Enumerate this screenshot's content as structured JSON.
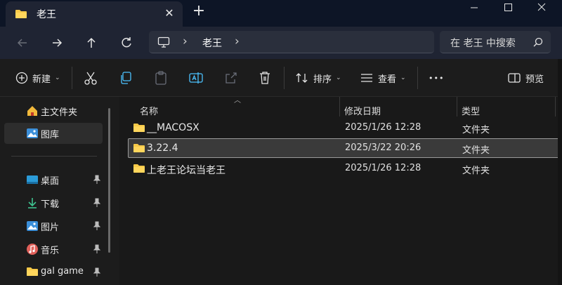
{
  "tab": {
    "title": "老王",
    "close_glyph": "✕",
    "new_tab_glyph": "+"
  },
  "window_controls": [
    "minimize-icon",
    "maximize-icon",
    "close-icon"
  ],
  "nav": {
    "buttons": [
      "back-arrow-icon",
      "forward-arrow-icon",
      "up-arrow-icon",
      "refresh-icon"
    ]
  },
  "address": {
    "separator": "›",
    "crumb": "老王",
    "trailing": "›"
  },
  "search": {
    "placeholder": "在 老王 中搜索"
  },
  "toolbar": {
    "new_label": "新建",
    "sort_label": "排序",
    "view_label": "查看",
    "more_glyph": "•••",
    "preview_label": "预览",
    "caret": "⌄"
  },
  "sidebar": {
    "items": [
      {
        "label": "主文件夹",
        "icon": "home-icon",
        "pinned": false
      },
      {
        "label": "图库",
        "icon": "gallery-icon",
        "pinned": false,
        "selected": true
      },
      {
        "label": "桌面",
        "icon": "desktop-icon",
        "pinned": true
      },
      {
        "label": "下载",
        "icon": "download-icon",
        "pinned": true
      },
      {
        "label": "图片",
        "icon": "pictures-icon",
        "pinned": true
      },
      {
        "label": "音乐",
        "icon": "music-icon",
        "pinned": true
      },
      {
        "label": "gal game",
        "icon": "folder-icon",
        "pinned": true
      }
    ]
  },
  "columns": {
    "name": "名称",
    "modified": "修改日期",
    "type": "类型"
  },
  "files": [
    {
      "name": "__MACOSX",
      "modified": "2025/1/26 12:28",
      "type": "文件夹"
    },
    {
      "name": "3.22.4",
      "modified": "2025/3/22 20:26",
      "type": "文件夹",
      "selected": true
    },
    {
      "name": "上老王论坛当老王",
      "modified": "2025/1/26 12:28",
      "type": "文件夹"
    }
  ],
  "colors": {
    "folder": "#f7c948",
    "accent": "#4cc2ff",
    "titlebar": "#0d1526",
    "tab": "#1f2433"
  }
}
